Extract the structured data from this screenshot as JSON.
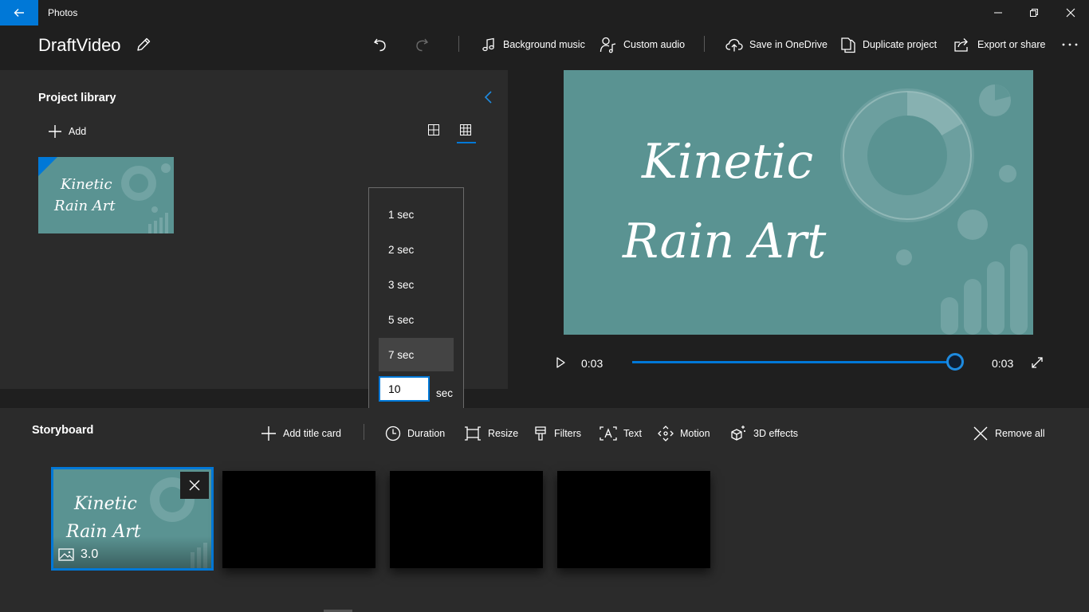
{
  "app": {
    "title": "Photos"
  },
  "header": {
    "project_name": "DraftVideo",
    "background_music": "Background music",
    "custom_audio": "Custom audio",
    "save_onedrive": "Save in OneDrive",
    "duplicate_project": "Duplicate project",
    "export_share": "Export or share"
  },
  "library": {
    "title": "Project library",
    "add_label": "Add",
    "thumb_line1": "Kinetic",
    "thumb_line2": "Rain Art"
  },
  "duration_menu": {
    "options": [
      "1 sec",
      "2 sec",
      "3 sec",
      "5 sec",
      "7 sec"
    ],
    "highlighted": "7 sec",
    "custom_value": "10",
    "unit": "sec"
  },
  "preview": {
    "line1": "Kinetic",
    "line2": "Rain Art",
    "current_time": "0:03",
    "total_time": "0:03",
    "progress": 1.0
  },
  "storyboard": {
    "title": "Storyboard",
    "add_title_card": "Add title card",
    "duration": "Duration",
    "resize": "Resize",
    "filters": "Filters",
    "text": "Text",
    "motion": "Motion",
    "effects_3d": "3D effects",
    "remove_all": "Remove all",
    "clip1": {
      "line1": "Kinetic",
      "line2": "Rain Art",
      "duration": "3.0"
    }
  },
  "colors": {
    "accent": "#0078d7",
    "teal": "#5a9392",
    "panel": "#2b2b2b",
    "background": "#1f1f1f"
  }
}
